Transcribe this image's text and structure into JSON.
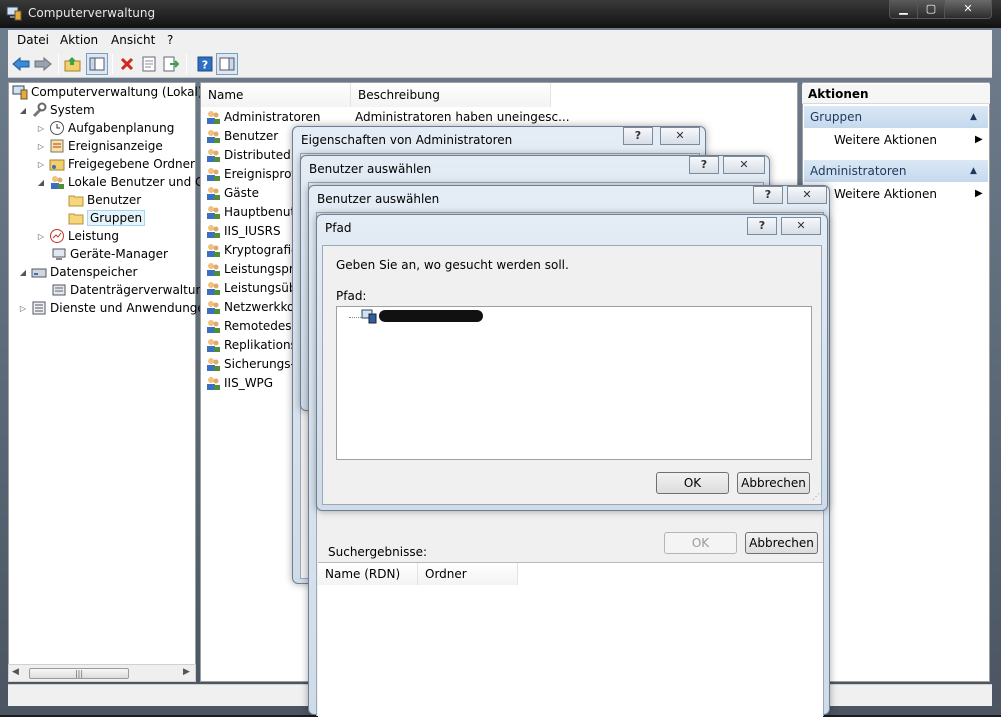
{
  "window": {
    "title": "Computerverwaltung",
    "min": "▁",
    "max": "▢",
    "close": "✕"
  },
  "menu": [
    "Datei",
    "Aktion",
    "Ansicht",
    "?"
  ],
  "tree": [
    {
      "label": "Computerverwaltung (Lokal)"
    },
    {
      "label": "System"
    },
    {
      "label": "Aufgabenplanung"
    },
    {
      "label": "Ereignisanzeige"
    },
    {
      "label": "Freigegebene Ordner"
    },
    {
      "label": "Lokale Benutzer und Gr"
    },
    {
      "label": "Benutzer"
    },
    {
      "label": "Gruppen"
    },
    {
      "label": "Leistung"
    },
    {
      "label": "Geräte-Manager"
    },
    {
      "label": "Datenspeicher"
    },
    {
      "label": "Datenträgerverwaltung"
    },
    {
      "label": "Dienste und Anwendungen"
    }
  ],
  "list": {
    "columns": [
      "Name",
      "Beschreibung"
    ],
    "rows": [
      {
        "name": "Administratoren",
        "desc": "Administratoren haben uneingesc..."
      },
      {
        "name": "Benutzer",
        "desc": ""
      },
      {
        "name": "Distributed C",
        "desc": ""
      },
      {
        "name": "Ereignisprotc",
        "desc": ""
      },
      {
        "name": "Gäste",
        "desc": ""
      },
      {
        "name": "Hauptbenutz",
        "desc": ""
      },
      {
        "name": "IIS_IUSRS",
        "desc": ""
      },
      {
        "name": "Kryptografie-",
        "desc": ""
      },
      {
        "name": "Leistungspro",
        "desc": ""
      },
      {
        "name": "Leistungsübe",
        "desc": ""
      },
      {
        "name": "Netzwerkkon",
        "desc": ""
      },
      {
        "name": "Remotedeskt",
        "desc": ""
      },
      {
        "name": "Replikations-",
        "desc": ""
      },
      {
        "name": "Sicherungs-C",
        "desc": ""
      },
      {
        "name": "IIS_WPG",
        "desc": ""
      }
    ]
  },
  "actions": {
    "title": "Aktionen",
    "section1": "Gruppen",
    "item1": "Weitere Aktionen",
    "section2": "Administratoren",
    "item2": "Weitere Aktionen"
  },
  "dialogs": {
    "props_title": "Eigenschaften von Administratoren",
    "select1_title": "Benutzer auswählen",
    "select2_title": "Benutzer auswählen",
    "help": "?",
    "close": "✕",
    "search_results": "Suchergebnisse:",
    "ok": "OK",
    "cancel": "Abbrechen",
    "results_columns": [
      "Name (RDN)",
      "Ordner"
    ],
    "path": {
      "title": "Pfad",
      "prompt": "Geben Sie an, wo gesucht werden soll.",
      "label": "Pfad:",
      "ok": "OK",
      "cancel": "Abbrechen"
    }
  },
  "colors": {
    "accent": "#1e395b",
    "section_bg": "#c5d9ee",
    "selection": "#e5f3fb"
  }
}
